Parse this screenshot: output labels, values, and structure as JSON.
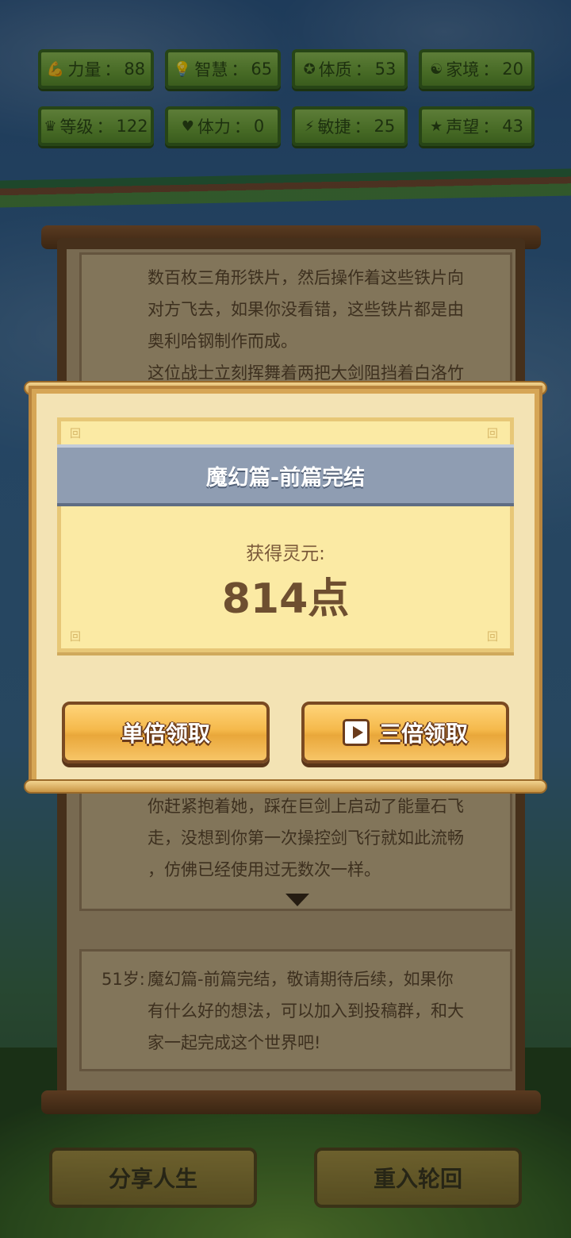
{
  "stats": [
    {
      "icon": "strength-icon",
      "glyph": "💪",
      "label": "力量",
      "value": "88"
    },
    {
      "icon": "bulb-icon",
      "glyph": "💡",
      "label": "智慧",
      "value": "65"
    },
    {
      "icon": "constitution-icon",
      "glyph": "✪",
      "label": "体质",
      "value": "53"
    },
    {
      "icon": "family-icon",
      "glyph": "☯",
      "label": "家境",
      "value": "20"
    },
    {
      "icon": "crown-icon",
      "glyph": "♛",
      "label": "等级",
      "value": "122"
    },
    {
      "icon": "heart-icon",
      "glyph": "♥",
      "label": "体力",
      "value": "0"
    },
    {
      "icon": "lightning-icon",
      "glyph": "⚡",
      "label": "敏捷",
      "value": "25"
    },
    {
      "icon": "star-icon",
      "glyph": "★",
      "label": "声望",
      "value": "43"
    }
  ],
  "story": {
    "top_lines": [
      "数百枚三角形铁片，然后操作着这些铁片向",
      "对方飞去，如果你没看错，这些铁片都是由",
      "奥利哈钢制作而成。",
      "这位战士立刻挥舞着两把大剑阻挡着白洛竹"
    ],
    "bottom_lines": [
      "你赶紧抱着她，踩在巨剑上启动了能量石飞",
      "走，没想到你第一次操控剑飞行就如此流畅",
      "，仿佛已经使用过无数次一样。"
    ],
    "final_age": "51岁:",
    "final_lines": [
      "魔幻篇-前篇完结，敬请期待后续，如果你",
      "有什么好的想法，可以加入到投稿群，和大",
      "家一起完成这个世界吧!"
    ]
  },
  "modal": {
    "title": "魔幻篇-前篇完结",
    "reward_label": "获得灵元:",
    "reward_value": "814点",
    "single_button": "单倍领取",
    "triple_button": "三倍领取"
  },
  "bottom": {
    "share_label": "分享人生",
    "restart_label": "重入轮回"
  }
}
